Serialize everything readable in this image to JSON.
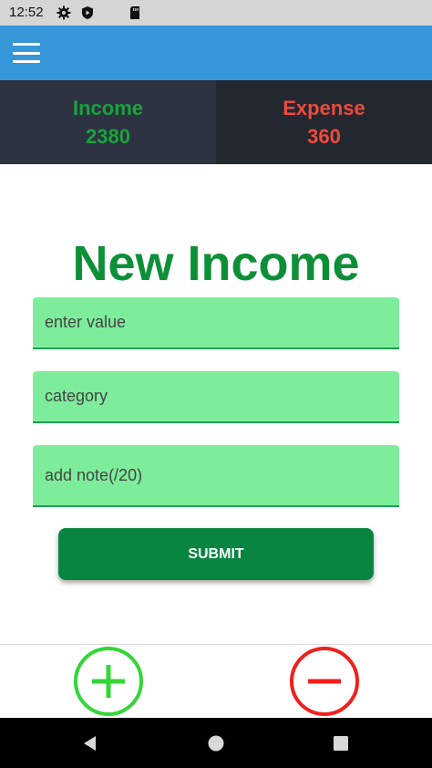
{
  "status_bar": {
    "time": "12:52",
    "icons": [
      "settings-icon",
      "play-protect-icon",
      "sd-card-icon"
    ]
  },
  "app_bar": {
    "menu_icon": "hamburger-menu-icon",
    "color": "#3597d8"
  },
  "summary": {
    "income": {
      "label": "Income",
      "value": "2380",
      "color": "#19a33c"
    },
    "expense": {
      "label": "Expense",
      "value": "360",
      "color": "#f04a3b"
    }
  },
  "form": {
    "title": "New Income",
    "value_field": {
      "placeholder": "enter value",
      "value": ""
    },
    "category_field": {
      "placeholder": "category",
      "value": ""
    },
    "note_field": {
      "placeholder": "add note(/20)",
      "value": ""
    },
    "submit_label": "SUBMIT"
  },
  "bottom_actions": {
    "add_icon": "plus-circle-icon",
    "remove_icon": "minus-circle-icon",
    "add_color": "#34d637",
    "remove_color": "#f0211d"
  },
  "nav_bar": {
    "icons": [
      "back-triangle-icon",
      "home-circle-icon",
      "recents-square-icon"
    ]
  }
}
